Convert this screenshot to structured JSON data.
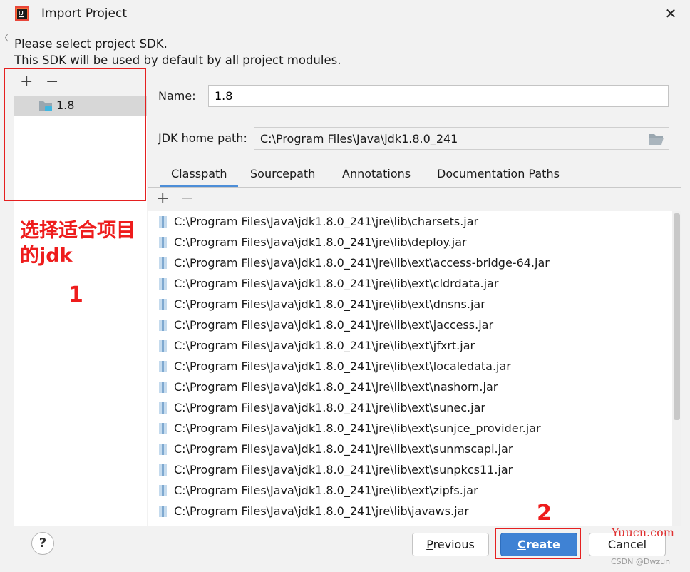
{
  "window": {
    "title": "Import Project"
  },
  "description": {
    "line1": "Please select project SDK.",
    "line2": "This SDK will be used by default by all project modules."
  },
  "sdk_list": {
    "add_label": "+",
    "remove_label": "−",
    "items": [
      {
        "label": "1.8",
        "selected": true
      }
    ]
  },
  "form": {
    "name_label": "Name:",
    "name_value": "1.8",
    "jdk_home_label": "JDK home path:",
    "jdk_home_value": "C:\\Program Files\\Java\\jdk1.8.0_241"
  },
  "tabs": [
    {
      "label": "Classpath",
      "active": true
    },
    {
      "label": "Sourcepath",
      "active": false
    },
    {
      "label": "Annotations",
      "active": false
    },
    {
      "label": "Documentation Paths",
      "active": false
    }
  ],
  "classpath": {
    "add_label": "+",
    "remove_label": "−",
    "items": [
      "C:\\Program Files\\Java\\jdk1.8.0_241\\jre\\lib\\charsets.jar",
      "C:\\Program Files\\Java\\jdk1.8.0_241\\jre\\lib\\deploy.jar",
      "C:\\Program Files\\Java\\jdk1.8.0_241\\jre\\lib\\ext\\access-bridge-64.jar",
      "C:\\Program Files\\Java\\jdk1.8.0_241\\jre\\lib\\ext\\cldrdata.jar",
      "C:\\Program Files\\Java\\jdk1.8.0_241\\jre\\lib\\ext\\dnsns.jar",
      "C:\\Program Files\\Java\\jdk1.8.0_241\\jre\\lib\\ext\\jaccess.jar",
      "C:\\Program Files\\Java\\jdk1.8.0_241\\jre\\lib\\ext\\jfxrt.jar",
      "C:\\Program Files\\Java\\jdk1.8.0_241\\jre\\lib\\ext\\localedata.jar",
      "C:\\Program Files\\Java\\jdk1.8.0_241\\jre\\lib\\ext\\nashorn.jar",
      "C:\\Program Files\\Java\\jdk1.8.0_241\\jre\\lib\\ext\\sunec.jar",
      "C:\\Program Files\\Java\\jdk1.8.0_241\\jre\\lib\\ext\\sunjce_provider.jar",
      "C:\\Program Files\\Java\\jdk1.8.0_241\\jre\\lib\\ext\\sunmscapi.jar",
      "C:\\Program Files\\Java\\jdk1.8.0_241\\jre\\lib\\ext\\sunpkcs11.jar",
      "C:\\Program Files\\Java\\jdk1.8.0_241\\jre\\lib\\ext\\zipfs.jar",
      "C:\\Program Files\\Java\\jdk1.8.0_241\\jre\\lib\\javaws.jar"
    ]
  },
  "buttons": {
    "help": "?",
    "previous": "Previous",
    "create": "Create",
    "cancel": "Cancel"
  },
  "annotations": {
    "step1_text": "选择适合项目的jdk",
    "step1_number": "1",
    "step2_number": "2",
    "color": "#ee1c1c"
  },
  "watermark": {
    "site": "Yuucn.com",
    "credit": "CSDN @Dwzun"
  },
  "colors": {
    "accent": "#3f82d4",
    "tab_underline": "#4d8ed8",
    "selection": "#d7d7d7",
    "dialog_bg": "#f2f2f2"
  },
  "icons": {
    "app": "intellij-idea-icon",
    "close": "close-icon",
    "sdk": "sdk-folder-icon",
    "browse": "folder-open-icon",
    "jar": "jar-file-icon"
  }
}
